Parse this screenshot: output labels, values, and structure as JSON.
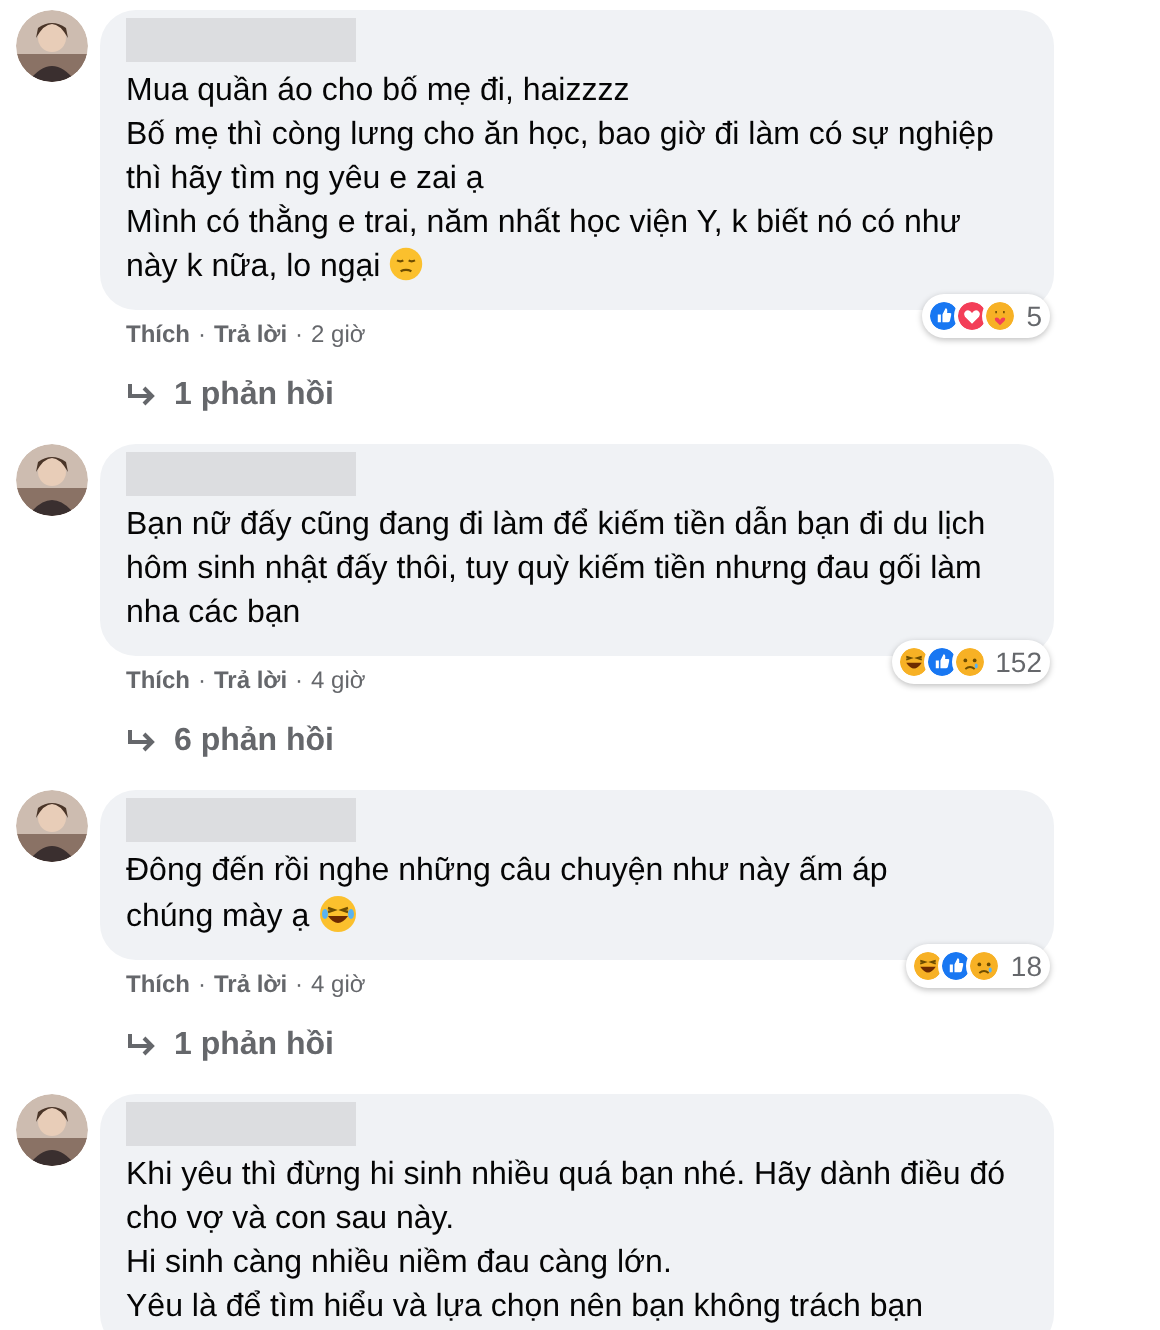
{
  "comments": [
    {
      "lines": [
        {
          "text": "Mua quần áo cho bố mẹ đi, haizzzz"
        },
        {
          "text": "Bố mẹ thì còng lưng cho ăn học, bao giờ đi làm có sự nghiệp thì hãy tìm ng yêu e zai ạ"
        },
        {
          "text": "Mình có thằng e trai, năm nhất học viện Y, k biết nó có như này k nữa, lo ngại",
          "emoji": {
            "kind": "pensive"
          }
        }
      ],
      "reactions": [
        {
          "kind": "like"
        },
        {
          "kind": "love"
        },
        {
          "kind": "care"
        }
      ],
      "reaction_count": "5",
      "meta": [
        {
          "kind": "link",
          "text": "Thích"
        },
        {
          "kind": "sep",
          "text": "·"
        },
        {
          "kind": "link",
          "text": "Trả lời"
        },
        {
          "kind": "sep",
          "text": "·"
        },
        {
          "kind": "time",
          "text": "2 giờ"
        }
      ],
      "replies": "1 phản hồi"
    },
    {
      "lines": [
        {
          "text": "Bạn nữ đấy cũng đang đi làm để kiếm tiền dẫn bạn đi du lịch hôm sinh nhật đấy thôi, tuy quỳ kiếm tiền nhưng đau gối làm nha các bạn"
        }
      ],
      "reactions": [
        {
          "kind": "haha"
        },
        {
          "kind": "like"
        },
        {
          "kind": "sad"
        }
      ],
      "reaction_count": "152",
      "meta": [
        {
          "kind": "link",
          "text": "Thích"
        },
        {
          "kind": "sep",
          "text": "·"
        },
        {
          "kind": "link",
          "text": "Trả lời"
        },
        {
          "kind": "sep",
          "text": "·"
        },
        {
          "kind": "time",
          "text": "4 giờ"
        }
      ],
      "replies": "6 phản hồi"
    },
    {
      "lines": [
        {
          "text": "Đông đến rồi nghe những câu chuyện như này ấm áp"
        },
        {
          "text": "chúng mày ạ",
          "emoji": {
            "kind": "joy"
          }
        }
      ],
      "reactions": [
        {
          "kind": "haha"
        },
        {
          "kind": "like"
        },
        {
          "kind": "sad"
        }
      ],
      "reaction_count": "18",
      "meta": [
        {
          "kind": "link",
          "text": "Thích"
        },
        {
          "kind": "sep",
          "text": "·"
        },
        {
          "kind": "link",
          "text": "Trả lời"
        },
        {
          "kind": "sep",
          "text": "·"
        },
        {
          "kind": "time",
          "text": "4 giờ"
        }
      ],
      "replies": "1 phản hồi"
    },
    {
      "lines": [
        {
          "text": "Khi yêu thì đừng hi sinh nhiều quá bạn nhé. Hãy dành điều đó cho vợ và con sau này."
        },
        {
          "text": "Hi sinh càng nhiều niềm đau càng lớn."
        },
        {
          "text": "Yêu là để tìm hiểu và lựa chọn nên bạn không trách bạn"
        }
      ]
    }
  ]
}
